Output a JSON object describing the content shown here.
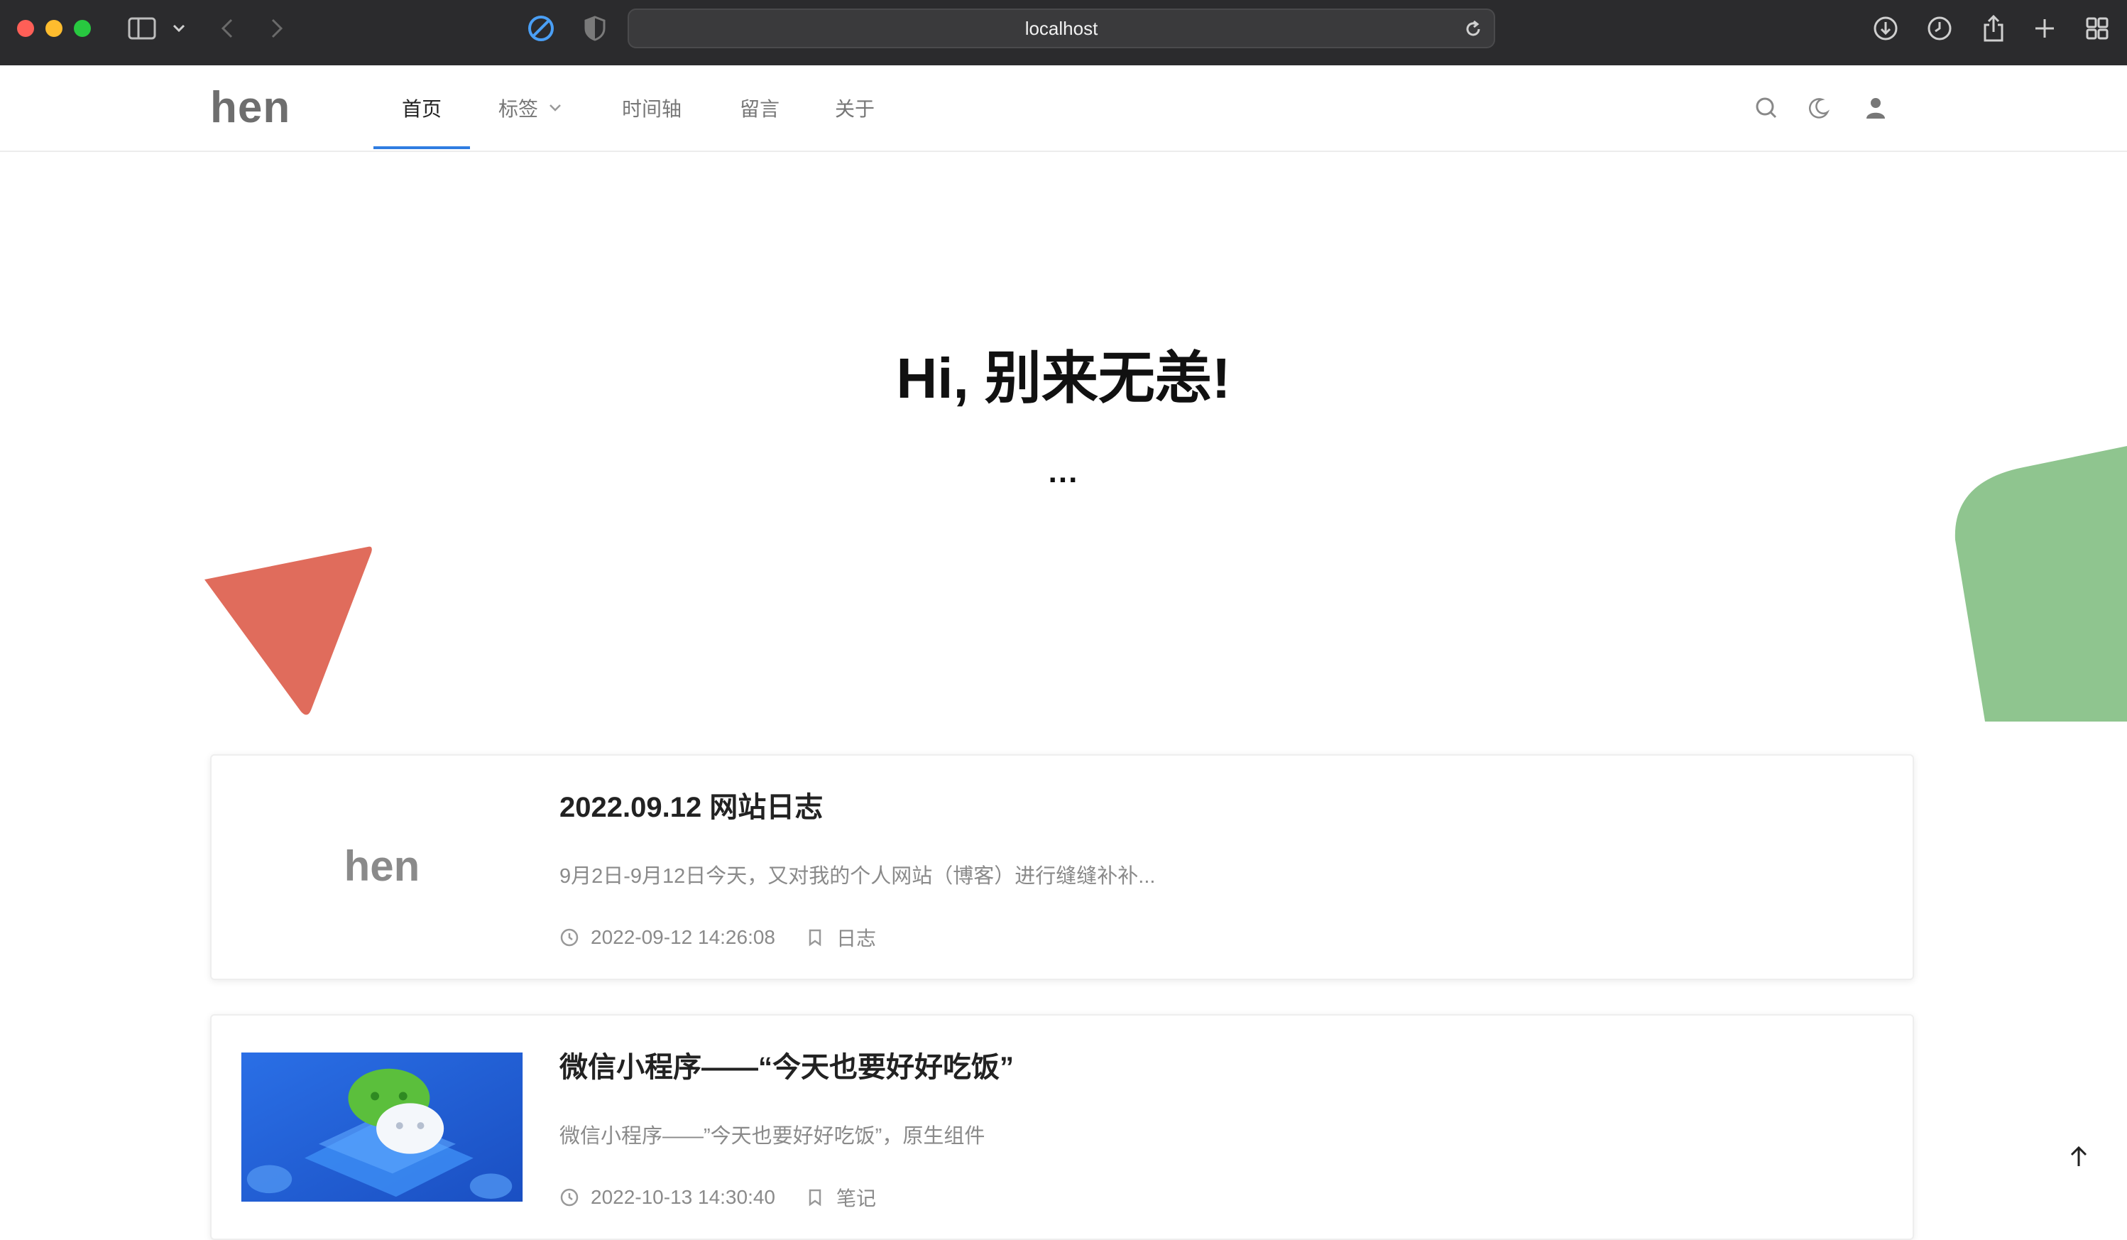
{
  "browser": {
    "url": "localhost"
  },
  "site": {
    "logo": "hen",
    "nav": [
      {
        "label": "首页",
        "active": true
      },
      {
        "label": "标签",
        "has_dropdown": true
      },
      {
        "label": "时间轴"
      },
      {
        "label": "留言"
      },
      {
        "label": "关于"
      }
    ]
  },
  "hero": {
    "title": "Hi, 别来无恙!",
    "subtitle": "..."
  },
  "articles": [
    {
      "thumb_logo": "hen",
      "title": "2022.09.12 网站日志",
      "summary": "9月2日-9月12日今天，又对我的个人网站（博客）进行缝缝补补...",
      "date": "2022-09-12 14:26:08",
      "tag": "日志"
    },
    {
      "title": "微信小程序——“今天也要好好吃饭”",
      "summary": "微信小程序——”今天也要好好吃饭”，原生组件",
      "date": "2022-10-13 14:30:40",
      "tag": "笔记"
    }
  ],
  "colors": {
    "accent": "#2f7de1",
    "triangle": "#e06c5c",
    "blob": "#8fc58f"
  }
}
